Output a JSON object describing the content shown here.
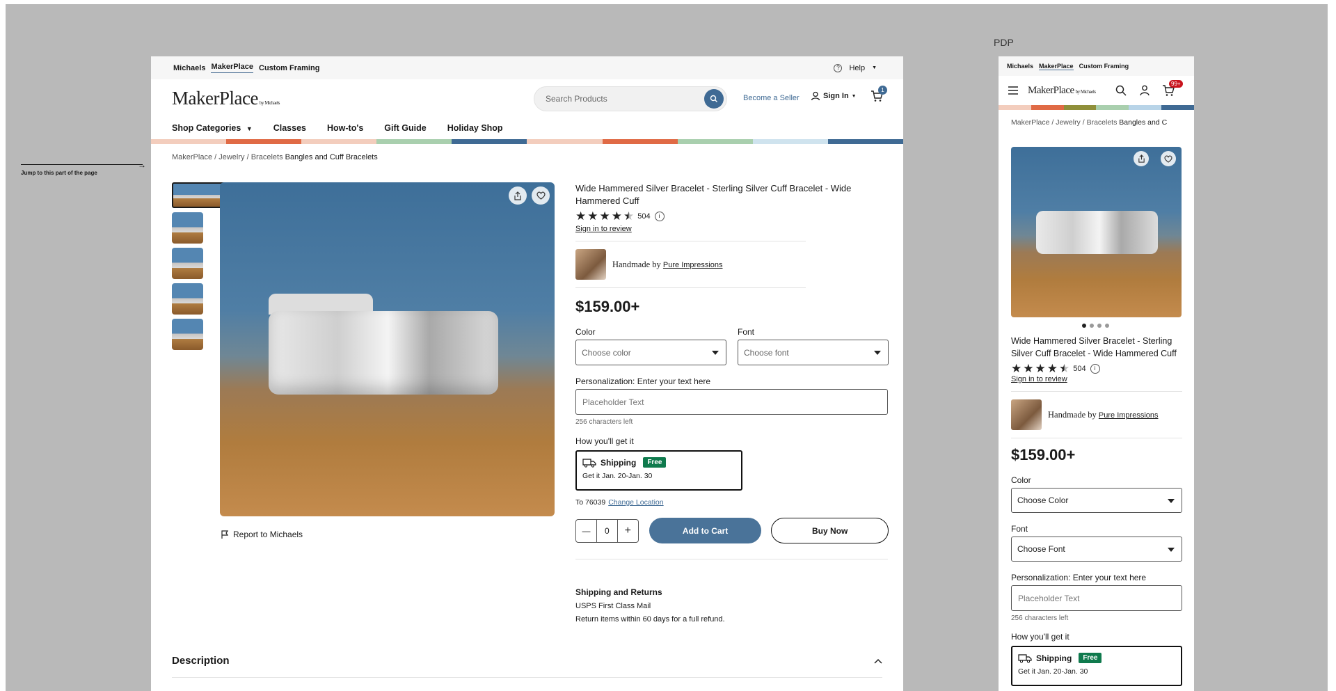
{
  "canvas": {
    "annotation": "Jump to this part of the page",
    "annotation_arrow": "→",
    "pdp_label": "PDP"
  },
  "desktop": {
    "util_nav": [
      "Michaels",
      "MakerPlace",
      "Custom Framing"
    ],
    "help": "Help",
    "logo": "MakerPlace",
    "logo_sub": "by Michaels",
    "search_placeholder": "Search Products",
    "become_seller": "Become a Seller",
    "sign_in": "Sign In",
    "cart_count": "1",
    "nav": [
      "Shop Categories",
      "Classes",
      "How-to's",
      "Gift Guide",
      "Holiday Shop"
    ],
    "color_bar": [
      "#f3cdbd",
      "#e06a45",
      "#f3cdbd",
      "#a9cfae",
      "#3f6a94",
      "#f3cdbd",
      "#e06a45",
      "#a9cfae",
      "#cfe3ee",
      "#3f6a94"
    ],
    "breadcrumb": [
      "MakerPlace",
      "Jewelry",
      "Bracelets"
    ],
    "breadcrumb_current": "Bangles and Cuff Bracelets",
    "report": "Report to Michaels",
    "product": {
      "title": "Wide Hammered Silver Bracelet - Sterling Silver Cuff Bracelet - Wide Hammered Cuff",
      "rating": 4.5,
      "review_count": "504",
      "sign_in_review": "Sign in to review",
      "handmade_by": "Handmade by",
      "seller": "Pure Impressions",
      "price": "$159.00+",
      "color_label": "Color",
      "color_placeholder": "Choose color",
      "font_label": "Font",
      "font_placeholder": "Choose font",
      "personalization_label": "Personalization: Enter your text here",
      "personalization_placeholder": "Placeholder Text",
      "chars_left": "256 characters left",
      "how_get": "How you'll get it",
      "shipping": "Shipping",
      "free": "Free",
      "ship_date": "Get it Jan. 20-Jan. 30",
      "to_zip": "To 76039",
      "change_location": "Change Location",
      "qty": "0",
      "add_to_cart": "Add to Cart",
      "buy_now": "Buy Now",
      "ship_returns_title": "Shipping and Returns",
      "ship_method": "USPS First Class Mail",
      "return_policy": "Return items within 60 days for a full refund."
    },
    "description": "Description"
  },
  "mobile": {
    "util_nav": [
      "Michaels",
      "MakerPlace",
      "Custom Framing"
    ],
    "logo": "MakerPlace",
    "logo_sub": "by Michaels",
    "cart_count": "99+",
    "color_bar": [
      "#f3cdbd",
      "#e06a45",
      "#8f8f3a",
      "#a9cfae",
      "#b8d4e8",
      "#3f6a94"
    ],
    "breadcrumb": [
      "MakerPlace",
      "Jewelry",
      "Bracelets"
    ],
    "breadcrumb_current": "Bangles and C",
    "carousel_dots": 4,
    "product": {
      "title": "Wide Hammered Silver Bracelet - Sterling Silver Cuff Bracelet - Wide Hammered Cuff",
      "review_count": "504",
      "sign_in_review": "Sign in to review",
      "handmade_by": "Handmade by",
      "seller": "Pure Impressions",
      "price": "$159.00+",
      "color_label": "Color",
      "color_placeholder": "Choose Color",
      "font_label": "Font",
      "font_placeholder": "Choose Font",
      "personalization_label": "Personalization: Enter your text here",
      "personalization_placeholder": "Placeholder Text",
      "chars_left": "256 characters left",
      "how_get": "How you'll get it",
      "shipping": "Shipping",
      "free": "Free",
      "ship_date": "Get it Jan. 20-Jan. 30"
    }
  }
}
